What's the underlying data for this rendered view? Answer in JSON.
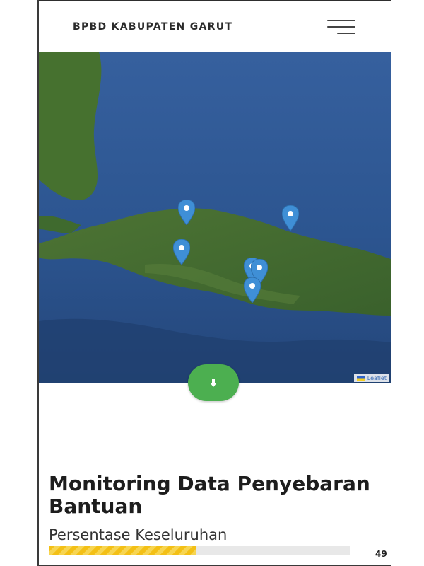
{
  "header": {
    "brand": "BPBD KABUPATEN GARUT",
    "menu_icon": "hamburger-icon"
  },
  "map": {
    "attribution": "Leaflet",
    "marker_count": 6,
    "colors": {
      "marker": "#3f8fd6",
      "sea": "#2a4f86",
      "land": "#3f6a2e"
    }
  },
  "fab": {
    "icon": "arrow-down-icon",
    "color": "#4caf50"
  },
  "content": {
    "title": "Monitoring Data Penyebaran Bantuan",
    "subtitle": "Persentase Keseluruhan",
    "progress_percent": 49,
    "progress_label": "49",
    "progress_color": "#f3c016"
  }
}
